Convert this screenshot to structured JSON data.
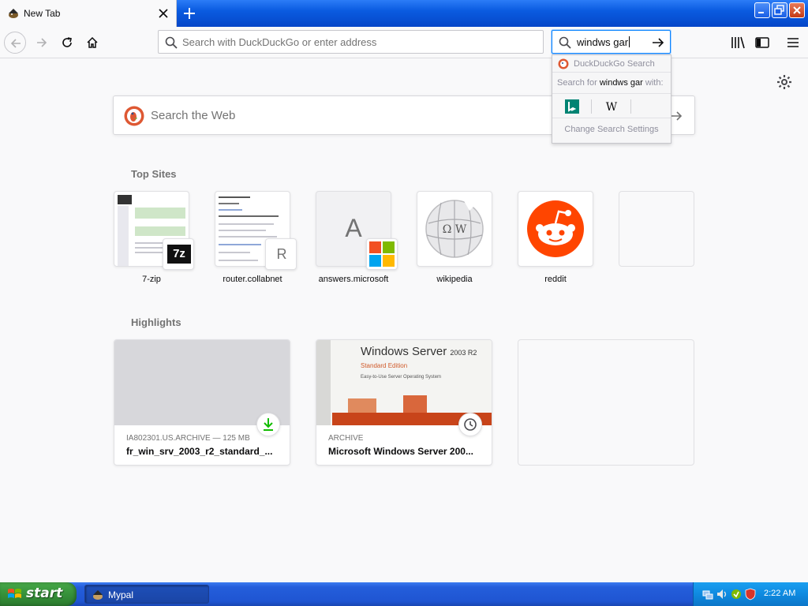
{
  "window": {
    "tab_title": "New Tab",
    "new_tab_tooltip_icon": "plus-icon"
  },
  "toolbar": {
    "url_placeholder": "Search with DuckDuckGo or enter address",
    "search_value": "windws gar"
  },
  "search_dropdown": {
    "engine_label": "DuckDuckGo Search",
    "search_for_prefix": "Search for ",
    "search_for_query": "windws gar",
    "search_for_suffix": " with:",
    "change_settings": "Change Search Settings",
    "engines": [
      "bing",
      "wikipedia"
    ]
  },
  "newtab": {
    "search_placeholder": "Search the Web",
    "top_sites_title": "Top Sites",
    "top_sites": [
      {
        "label": "7-zip",
        "badge_text": "7z"
      },
      {
        "label": "router.collabnet",
        "badge_text": "R"
      },
      {
        "label": "answers.microsoft",
        "letter": "A"
      },
      {
        "label": "wikipedia",
        "wiki_letters": "Ω W"
      },
      {
        "label": "reddit"
      },
      {
        "label": ""
      }
    ],
    "highlights_title": "Highlights",
    "highlights": [
      {
        "meta": "IA802301.US.ARCHIVE — 125 MB",
        "title": "fr_win_srv_2003_r2_standard_..."
      },
      {
        "meta": "ARCHIVE",
        "title": "Microsoft Windows Server 200...",
        "box_title": "Windows Server",
        "box_ver": "2003 R2",
        "box_edition": "Standard Edition",
        "box_sub": "Easy-to-Use Server Operating System"
      }
    ]
  },
  "taskbar": {
    "start_label": "start",
    "task_label": "Mypal",
    "clock": "2:22 AM"
  },
  "colors": {
    "accent": "#0a84ff",
    "reddit": "#ff4500",
    "xp_blue": "#245edb",
    "xp_green": "#36913a"
  }
}
